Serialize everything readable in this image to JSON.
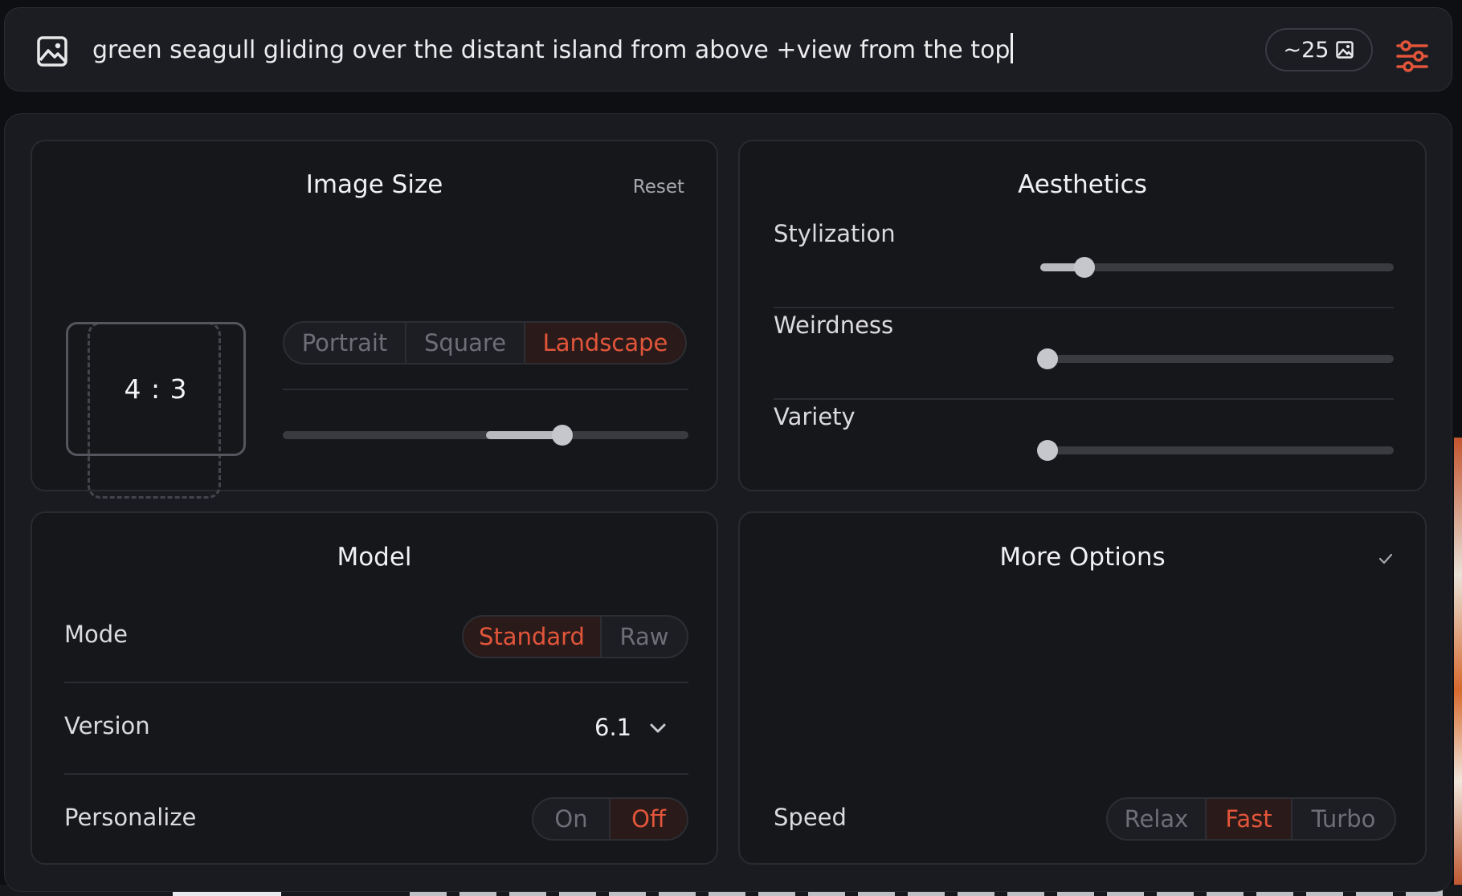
{
  "prompt": {
    "text": "green seagull gliding over the distant island from above +view from the top",
    "count_label": "~25",
    "accent": "#e2553a"
  },
  "image_size": {
    "title": "Image Size",
    "reset_label": "Reset",
    "ratio": "4 : 3",
    "orientation_options": [
      "Portrait",
      "Square",
      "Landscape"
    ],
    "selected_orientation": "Landscape",
    "ratio_slider": {
      "value_fraction": 0.69,
      "center_fraction": 0.5
    }
  },
  "aesthetics": {
    "title": "Aesthetics",
    "sliders": [
      {
        "label": "Stylization",
        "value_fraction": 0.11
      },
      {
        "label": "Weirdness",
        "value_fraction": 0.0
      },
      {
        "label": "Variety",
        "value_fraction": 0.0
      }
    ]
  },
  "model": {
    "title": "Model",
    "mode_label": "Mode",
    "mode_options": [
      "Standard",
      "Raw"
    ],
    "selected_mode": "Standard",
    "version_label": "Version",
    "version_value": "6.1",
    "personalize_label": "Personalize",
    "personalize_options": [
      "On",
      "Off"
    ],
    "selected_personalize": "Off"
  },
  "more_options": {
    "title": "More Options",
    "speed_label": "Speed",
    "speed_options": [
      "Relax",
      "Fast",
      "Turbo"
    ],
    "selected_speed": "Fast"
  },
  "icons": {
    "prompt": "image-icon",
    "count": "image-count-icon",
    "settings": "sliders-icon",
    "version": "chevron-down-icon",
    "more": "check-icon"
  }
}
